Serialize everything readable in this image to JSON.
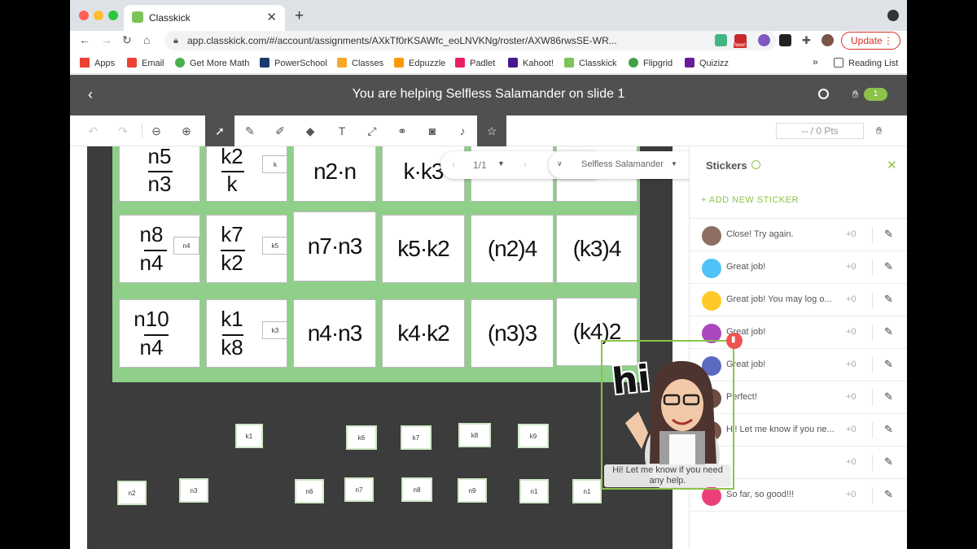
{
  "browser": {
    "tab_title": "Classkick",
    "tab_close": "✕",
    "new_tab": "+",
    "url": "app.classkick.com/#/account/assignments/AXkTf0rKSAWfc_eoLNVKNg/roster/AXW86rwsSE-WR...",
    "update_label": "Update",
    "new_badge": "New!",
    "bookmarks": [
      "Apps",
      "Email",
      "Get More Math",
      "PowerSchool",
      "Classes",
      "Edpuzzle",
      "Padlet",
      "Kahoot!",
      "Classkick",
      "Flipgrid",
      "Quizizz"
    ],
    "bookmark_more": "»",
    "reading_list": "Reading List"
  },
  "header": {
    "title": "You are helping Selfless Salamander on slide 1",
    "hand_count": "1"
  },
  "toolbar": {
    "points": "-- / 0 Pts"
  },
  "slide_nav": {
    "page": "1/1",
    "student": "Selfless Salamander"
  },
  "board": {
    "row1": {
      "frac1_num": "n5",
      "frac1_den": "n3",
      "frac2_num": "k2",
      "frac2_den": "k",
      "mini": "k",
      "c3": "n2·n",
      "c4": "k·k3"
    },
    "row2": {
      "frac1_num": "n8",
      "frac1_den": "n4",
      "frac1_mini": "n4",
      "frac2_num": "k7",
      "frac2_den": "k2",
      "frac2_mini": "k5",
      "c3": "n7·n3",
      "c4": "k5·k2",
      "c5": "(n2)4",
      "c6": "(k3)4"
    },
    "row3": {
      "frac1_num": "n10",
      "frac1_den": "n4",
      "frac2_num": "k1",
      "frac2_den": "k8",
      "frac2_mini": "k3",
      "c3": "n4·n3",
      "c4": "k4·k2",
      "c5": "(n3)3",
      "c6": "(k4)2"
    }
  },
  "tiles_top": [
    "k1",
    "k6",
    "k7",
    "k8",
    "k9"
  ],
  "tiles_bottom": [
    "n2",
    "n3",
    "n6",
    "n7",
    "n8",
    "n9",
    "n1",
    "n1"
  ],
  "sticker_panel": {
    "title": "Stickers",
    "add_new": "+ ADD NEW STICKER",
    "stickers": [
      {
        "label": "Close! Try again.",
        "points": "+0"
      },
      {
        "label": "Great job!",
        "points": "+0"
      },
      {
        "label": "Great job! You may log o...",
        "points": "+0"
      },
      {
        "label": "Great job!",
        "points": "+0"
      },
      {
        "label": "Great job!",
        "points": "+0"
      },
      {
        "label": "Perfect!",
        "points": "+0"
      },
      {
        "label": "Hi! Let me know if you ne...",
        "points": "+0"
      },
      {
        "label": "",
        "points": "+0"
      },
      {
        "label": "So far, so good!!!",
        "points": "+0"
      }
    ]
  },
  "placed_sticker": {
    "greeting": "hi",
    "caption": "Hi! Let me know if you need any help."
  },
  "colors": {
    "accent_green": "#8bc34a",
    "header_gray": "#505050",
    "board_green": "#8fcf8a",
    "delete_red": "#ef5350"
  }
}
